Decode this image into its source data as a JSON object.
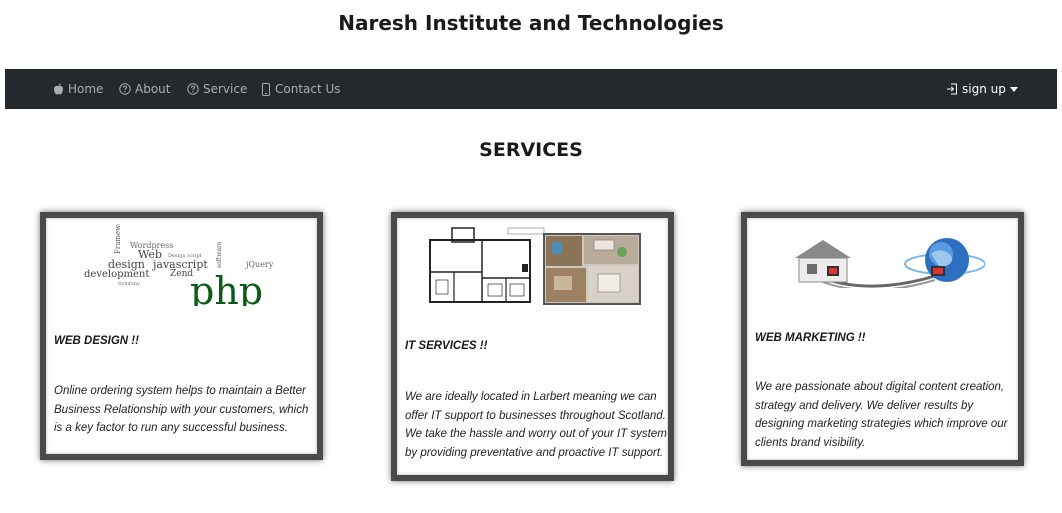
{
  "site": {
    "title": "Naresh Institute and Technologies"
  },
  "nav": {
    "items": [
      {
        "label": "Home",
        "icon": "apple-icon"
      },
      {
        "label": "About",
        "icon": "question-circle-icon"
      },
      {
        "label": "Service",
        "icon": "question-circle-icon"
      },
      {
        "label": "Contact Us",
        "icon": "phone-icon"
      }
    ],
    "signup": {
      "label": "sign up",
      "icon": "sign-in-icon"
    }
  },
  "colors": {
    "navbar": "#24292e",
    "nav_text": "#a9adb2",
    "card_border": "#4a4a4a"
  },
  "section": {
    "title": "SERVICES"
  },
  "cards": [
    {
      "heading": "WEB DESIGN !!",
      "text": "Online ordering system helps to maintain a Better Business Relationship with your customers, which is a key factor to run any successful business.",
      "image": "php-word-cloud-image",
      "image_words": [
        "Framework",
        "Wordpress",
        "Web",
        "Design script",
        "design",
        "javascript",
        "development",
        "Zend",
        "Symfony",
        "php",
        "jQuery",
        "software"
      ]
    },
    {
      "heading": "IT SERVICES !!",
      "text": "We are ideally located in Larbert meaning we can offer IT support to businesses throughout Scotland. We take the hassle and worry out of your IT system by providing preventative and proactive IT support.",
      "image": "floor-plan-image"
    },
    {
      "heading": "WEB MARKETING !!",
      "text": "We are passionate about digital content creation, strategy and delivery. We deliver results by designing marketing strategies which improve our clients brand visibility.",
      "image": "house-globe-network-image"
    }
  ]
}
